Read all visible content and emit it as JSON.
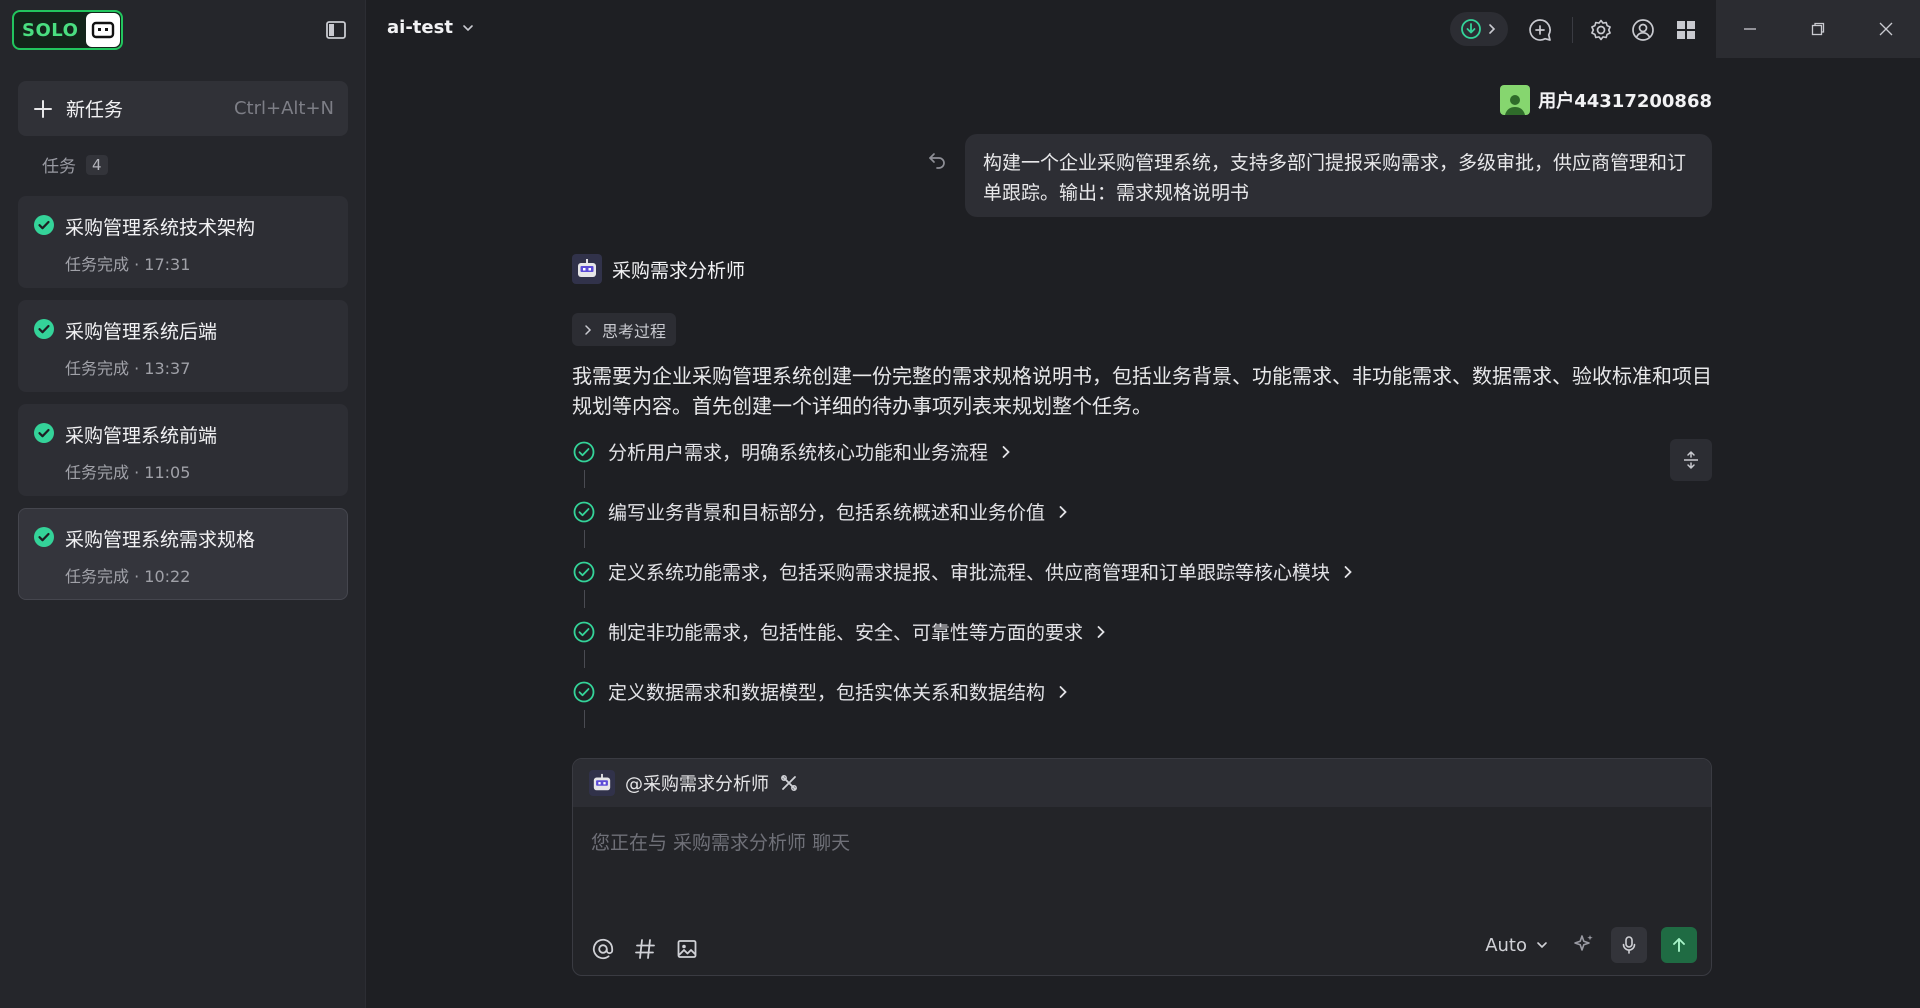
{
  "sidebar": {
    "logo_text": "SOLO",
    "new_task": {
      "label": "新任务",
      "shortcut": "Ctrl+Alt+N"
    },
    "tasks_label": "任务",
    "tasks_count": "4",
    "tasks": [
      {
        "title": "采购管理系统技术架构",
        "meta": "任务完成 · 17:31"
      },
      {
        "title": "采购管理系统后端",
        "meta": "任务完成 · 13:37"
      },
      {
        "title": "采购管理系统前端",
        "meta": "任务完成 · 11:05"
      },
      {
        "title": "采购管理系统需求规格",
        "meta": "任务完成 · 10:22"
      }
    ]
  },
  "topbar": {
    "project_name": "ai-test"
  },
  "chat": {
    "user_name": "用户44317200868",
    "user_message": "构建一个企业采购管理系统，支持多部门提报采购需求，多级审批，供应商管理和订单跟踪。输出：需求规格说明书",
    "agent_name": "采购需求分析师",
    "thinking_label": "思考过程",
    "agent_message": "我需要为企业采购管理系统创建一份完整的需求规格说明书，包括业务背景、功能需求、非功能需求、数据需求、验收标准和项目规划等内容。首先创建一个详细的待办事项列表来规划整个任务。",
    "todos": [
      "分析用户需求，明确系统核心功能和业务流程",
      "编写业务背景和目标部分，包括系统概述和业务价值",
      "定义系统功能需求，包括采购需求提报、审批流程、供应商管理和订单跟踪等核心模块",
      "制定非功能需求，包括性能、安全、可靠性等方面的要求",
      "定义数据需求和数据模型，包括实体关系和数据结构"
    ]
  },
  "input": {
    "mention": "@采购需求分析师",
    "placeholder": "您正在与 采购需求分析师 聊天",
    "model": "Auto"
  },
  "colors": {
    "accent": "#22c55e",
    "success": "#34d399",
    "background": "#1e1f23",
    "sidebar": "#25262b"
  }
}
